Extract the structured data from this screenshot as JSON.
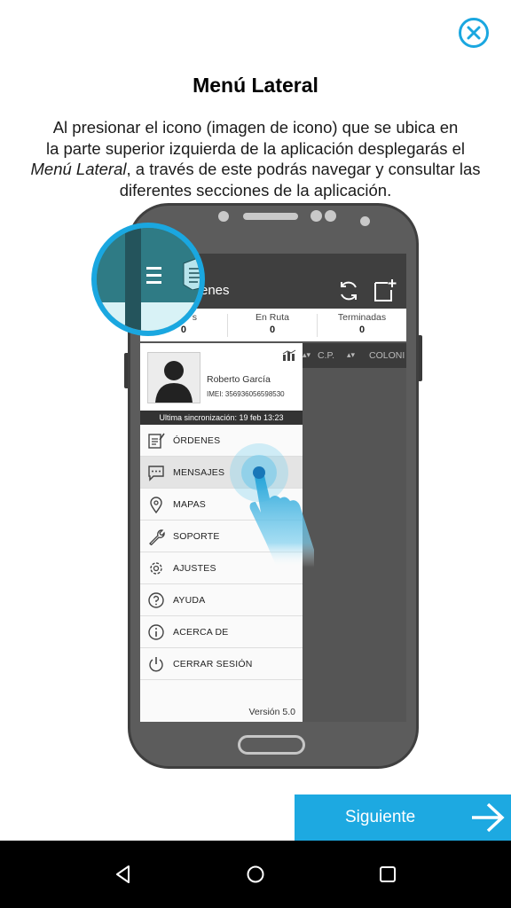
{
  "header": {
    "title": "Menú Lateral",
    "description_lines": [
      "Al presionar el icono (imagen de icono) que se ubica en",
      "la parte superior izquierda de la aplicación desplegarás el"
    ],
    "description_emphasis": "Menú Lateral",
    "description_rest": ", a través de este podrás navegar y consultar las",
    "description_last": "diferentes secciones de la aplicación."
  },
  "app_screen": {
    "title_fragment": "enes",
    "tabs": [
      {
        "label": "s",
        "count": "0"
      },
      {
        "label": "En Ruta",
        "count": "0"
      },
      {
        "label": "Terminadas",
        "count": "0"
      }
    ],
    "columns": [
      "C.P.",
      "COLONI"
    ],
    "user": {
      "name": "Roberto García",
      "imei": "IMEI: 356936056598530"
    },
    "sync": "Ultima sincronización: 19 feb 13:23",
    "menu": [
      {
        "label": "ÓRDENES",
        "icon": "orders-icon"
      },
      {
        "label": "MENSAJES",
        "icon": "message-icon"
      },
      {
        "label": "MAPAS",
        "icon": "map-pin-icon"
      },
      {
        "label": "SOPORTE",
        "icon": "wrench-icon"
      },
      {
        "label": "AJUSTES",
        "icon": "gear-icon"
      },
      {
        "label": "AYUDA",
        "icon": "help-icon"
      },
      {
        "label": "ACERCA DE",
        "icon": "info-icon"
      },
      {
        "label": "CERRAR SESIÓN",
        "icon": "power-icon"
      }
    ],
    "active_menu_item": "MENSAJES",
    "version": "Versión 5.0"
  },
  "footer": {
    "next_label": "Siguiente"
  },
  "colors": {
    "accent": "#1aa7e0",
    "button": "#1da9e1",
    "nav_bar": "#000000"
  }
}
